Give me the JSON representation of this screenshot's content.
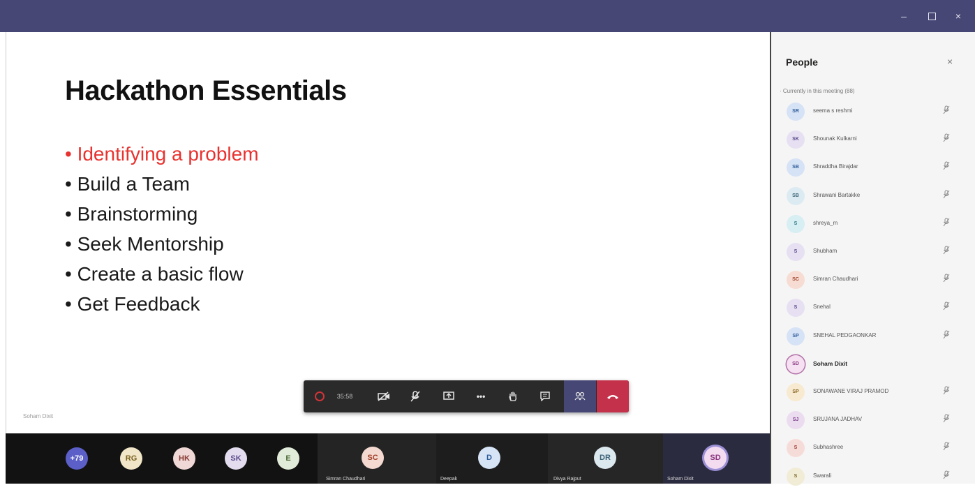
{
  "window": {
    "minimize": "–",
    "close": "×"
  },
  "slide": {
    "title": "Hackathon Essentials",
    "bullets": [
      "• Identifying a problem",
      "• Build a Team",
      "• Brainstorming",
      "• Seek Mentorship",
      "• Create a basic flow",
      "• Get Feedback"
    ],
    "active_bullet_color": "#e8322f",
    "presenter": "Soham Dixit"
  },
  "controls": {
    "timer": "35:58",
    "icons": {
      "camera": "✕",
      "mic": "✕",
      "share": "⇪",
      "more": "•••",
      "hand": "✋",
      "chat": "☐",
      "participants": "☷",
      "hangup": "☎"
    },
    "accent": "#464775",
    "hangup_color": "#c4314b"
  },
  "strip": {
    "avatars": [
      {
        "initials": "+79",
        "bg": "#5b5fc7",
        "fg": "#ffffff"
      },
      {
        "initials": "RG",
        "bg": "#f2e6c8",
        "fg": "#7a6220"
      },
      {
        "initials": "HK",
        "bg": "#efd8d6",
        "fg": "#8a3b33"
      },
      {
        "initials": "SK",
        "bg": "#e3dcef",
        "fg": "#5b4a8a"
      },
      {
        "initials": "E",
        "bg": "#e0ecd9",
        "fg": "#4b6b38"
      }
    ],
    "tiles": [
      {
        "initials": "SC",
        "bg": "#f4d9d0",
        "fg": "#a0412a",
        "name": "Simran Chaudhari"
      },
      {
        "initials": "D",
        "bg": "#d6e4f6",
        "fg": "#2f5d9a",
        "name": "Deepak"
      },
      {
        "initials": "DR",
        "bg": "#dbe8ee",
        "fg": "#3d6377",
        "name": "Divya Rajput"
      },
      {
        "initials": "SD",
        "bg": "#f3dcf0",
        "fg": "#8a3580",
        "name": "Soham Dixit"
      }
    ]
  },
  "people": {
    "title": "People",
    "close": "×",
    "section": "· Currently in this meeting (88)",
    "rows": [
      {
        "initials": "SR",
        "bg": "#d6e2f5",
        "fg": "#2f5d9a",
        "name": "seema s reshmi",
        "bold": false
      },
      {
        "initials": "SK",
        "bg": "#e6e0f2",
        "fg": "#5b4a8a",
        "name": "Shounak Kulkarni",
        "bold": false
      },
      {
        "initials": "SB",
        "bg": "#d6e2f5",
        "fg": "#2f5d9a",
        "name": "Shraddha Birajdar",
        "bold": false
      },
      {
        "initials": "SB",
        "bg": "#dcebf2",
        "fg": "#3d6377",
        "name": "Shrawani Bartakke",
        "bold": false
      },
      {
        "initials": "S",
        "bg": "#d7eef3",
        "fg": "#2f7a8a",
        "name": "shreya_m",
        "bold": false
      },
      {
        "initials": "S",
        "bg": "#e6e0f2",
        "fg": "#5b4a8a",
        "name": "Shubham",
        "bold": false
      },
      {
        "initials": "SC",
        "bg": "#f6dcd2",
        "fg": "#a0412a",
        "name": "Simran Chaudhari",
        "bold": false
      },
      {
        "initials": "S",
        "bg": "#e6e0f2",
        "fg": "#5b4a8a",
        "name": "Snehal",
        "bold": false
      },
      {
        "initials": "SP",
        "bg": "#d6e2f5",
        "fg": "#2f5d9a",
        "name": "SNEHAL PEDGAONKAR",
        "bold": false
      },
      {
        "initials": "SD",
        "bg": "#f6e1f2",
        "fg": "#8a3580",
        "name": "Soham Dixit",
        "bold": true
      },
      {
        "initials": "SP",
        "bg": "#f7ead0",
        "fg": "#8a6420",
        "name": "SONAWANE VIRAJ PRAMOD",
        "bold": false
      },
      {
        "initials": "SJ",
        "bg": "#ecdcf0",
        "fg": "#7a3d8a",
        "name": "SRUJANA JADHAV",
        "bold": false
      },
      {
        "initials": "S",
        "bg": "#f6dcd8",
        "fg": "#9a3f38",
        "name": "Subhashree",
        "bold": false
      },
      {
        "initials": "S",
        "bg": "#f1ecd6",
        "fg": "#7a6a2a",
        "name": "Swarali",
        "bold": false
      }
    ],
    "mic_icon": "🎤︎"
  }
}
